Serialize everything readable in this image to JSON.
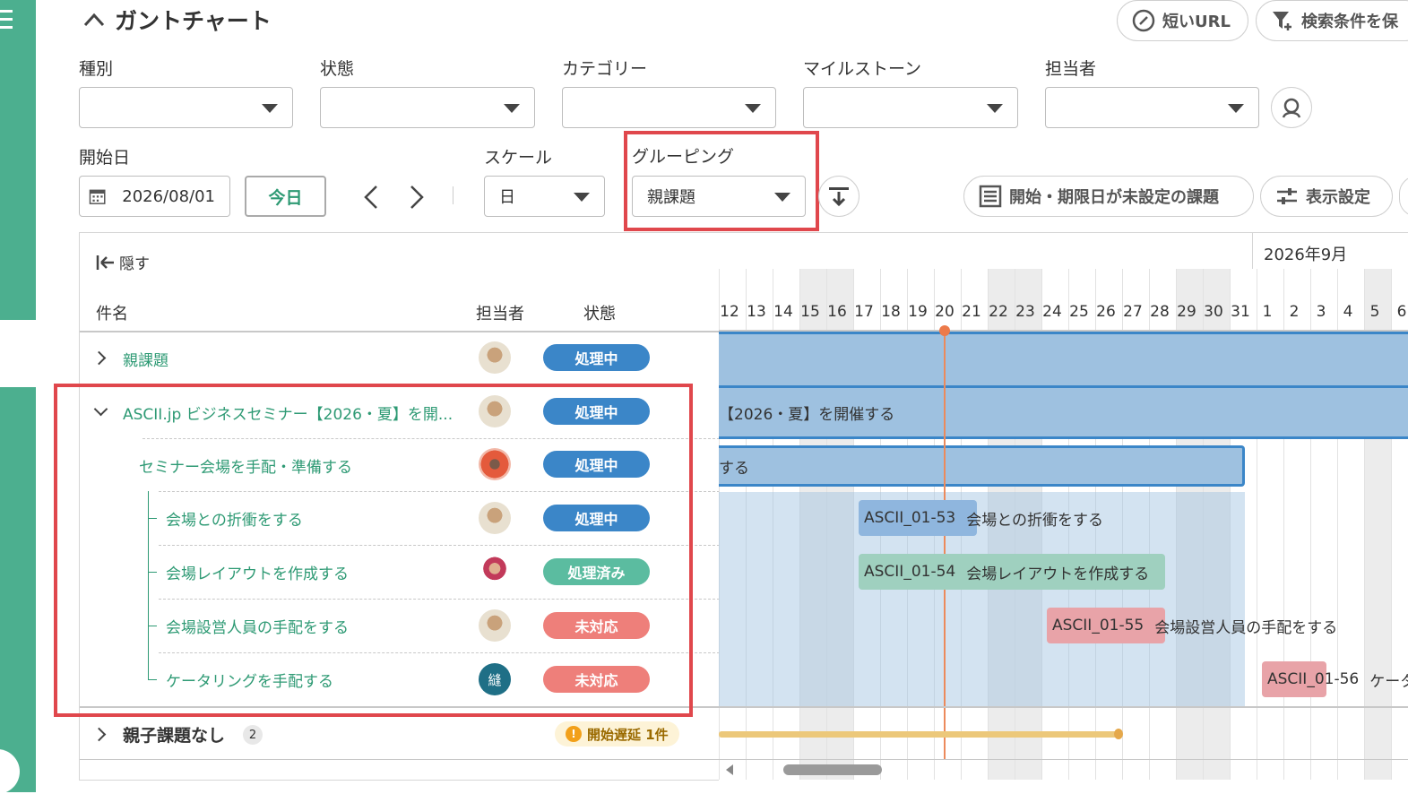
{
  "header": {
    "title": "ガントチャート",
    "short_url": "短いURL",
    "save_search": "検索条件を保"
  },
  "filters": {
    "type_label": "種別",
    "status_label": "状態",
    "category_label": "カテゴリー",
    "milestone_label": "マイルストーン",
    "assignee_label": "担当者",
    "start_label": "開始日",
    "start_value": "2026/08/01",
    "today": "今日",
    "scale_label": "スケール",
    "scale_value": "日",
    "grouping_label": "グルーピング",
    "grouping_value": "親課題",
    "unset_btn": "開始・期限日が未設定の課題",
    "display_btn": "表示設定"
  },
  "list": {
    "hide": "隠す",
    "col_name": "件名",
    "col_assignee": "担当者",
    "col_status": "状態",
    "rows": [
      {
        "name": "親課題",
        "status": "処理中"
      },
      {
        "name": "ASCII.jp ビジネスセミナー【2026・夏】を開...",
        "status": "処理中"
      },
      {
        "name": "セミナー会場を手配・準備する",
        "status": "処理中"
      },
      {
        "name": "会場との折衝をする",
        "status": "処理中"
      },
      {
        "name": "会場レイアウトを作成する",
        "status": "処理済み"
      },
      {
        "name": "会場設営人員の手配をする",
        "status": "未対応"
      },
      {
        "name": "ケータリングを手配する",
        "status": "未対応"
      }
    ],
    "no_parent": "親子課題なし",
    "no_parent_count": "2",
    "delay_badge": "開始遅延 1件",
    "avatar_initial": "縫"
  },
  "gantt": {
    "month": "2026年9月",
    "days": [
      "12",
      "13",
      "14",
      "15",
      "16",
      "17",
      "18",
      "19",
      "20",
      "21",
      "22",
      "23",
      "24",
      "25",
      "26",
      "27",
      "28",
      "29",
      "30",
      "31",
      "1",
      "2",
      "3",
      "4",
      "5",
      "6"
    ],
    "bars": {
      "parent_text": "【2026・夏】を開催する",
      "sub_text": "する",
      "b1_key": "ASCII_01-53",
      "b1_text": "会場との折衝をする",
      "b2_key": "ASCII_01-54",
      "b2_text": "会場レイアウトを作成する",
      "b3_key": "ASCII_01-55",
      "b3_text": "会場設営人員の手配をする",
      "b4_key": "ASCII_01-56",
      "b4_text": "ケータ"
    }
  },
  "colors": {
    "accent": "#2e9a74",
    "in_progress": "#3b86c8",
    "resolved": "#5bbca0",
    "open": "#ee7f7a",
    "highlight": "#e0474c"
  }
}
